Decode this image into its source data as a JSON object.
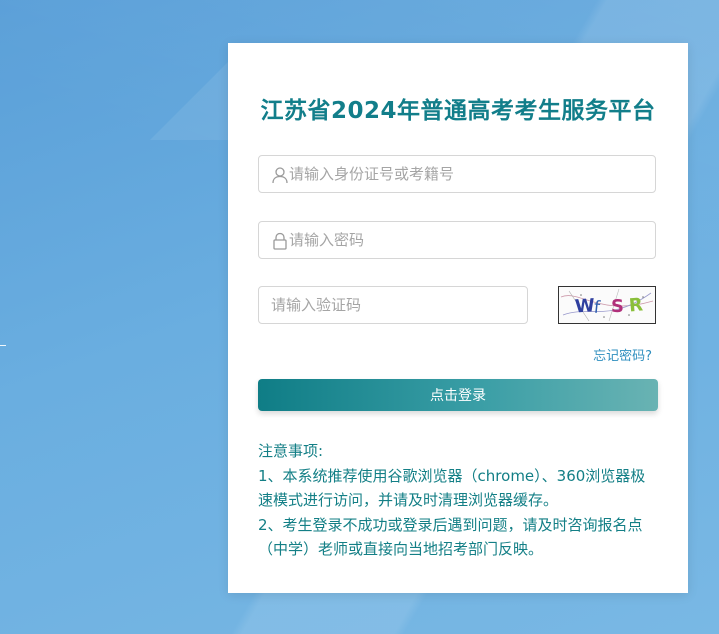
{
  "login": {
    "title": "江苏省2024年普通高考考生服务平台",
    "id_placeholder": "请输入身份证号或考籍号",
    "password_placeholder": "请输入密码",
    "captcha_placeholder": "请输入验证码",
    "captcha_text": "WfSR",
    "forgot_label": "忘记密码?",
    "login_label": "点击登录",
    "user_icon": "user-icon",
    "lock_icon": "lock-icon"
  },
  "notice": {
    "heading": "注意事项:",
    "item1": "1、本系统推荐使用谷歌浏览器（chrome）、360浏览器极速模式进行访问，并请及时清理浏览器缓存。",
    "item2": "2、考生登录不成功或登录后遇到问题，请及时咨询报名点（中学）老师或直接向当地招考部门反映。"
  },
  "colors": {
    "accent": "#127e8a",
    "link": "#2f8fbf",
    "background": "#6aaee0"
  }
}
